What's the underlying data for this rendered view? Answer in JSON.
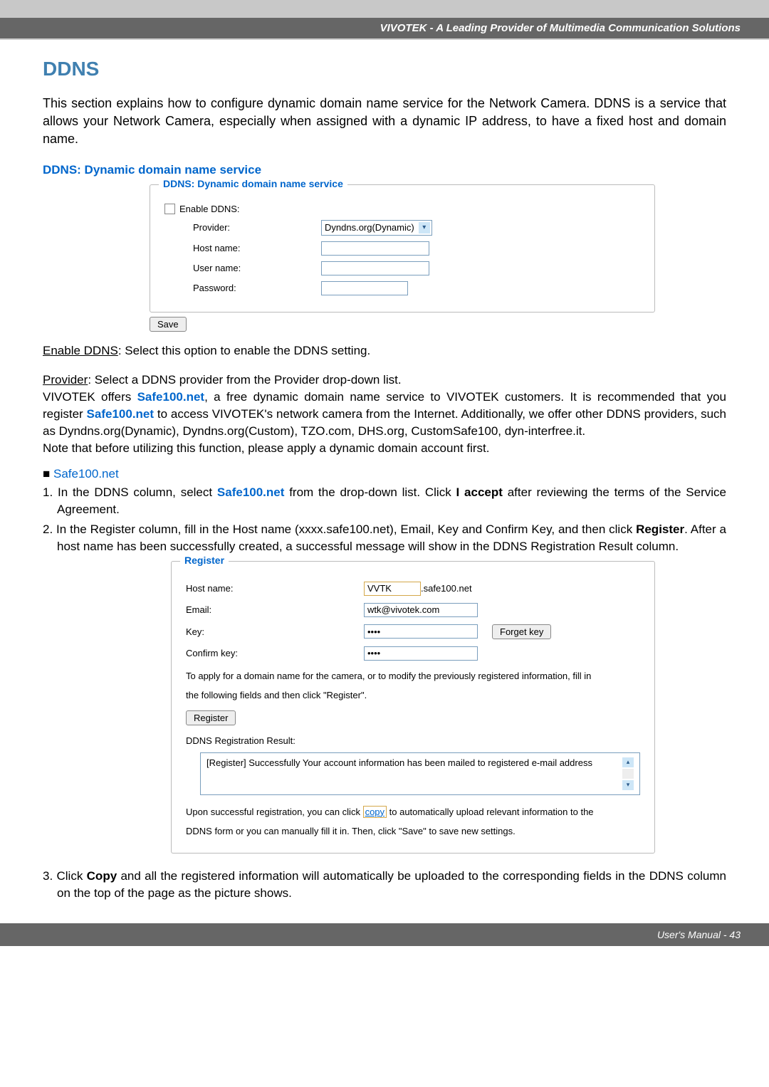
{
  "header": {
    "title": "VIVOTEK - A Leading Provider of Multimedia Communication Solutions"
  },
  "section": {
    "title": "DDNS",
    "intro": "This section explains how to configure dynamic domain name service for the Network Camera. DDNS is a service that allows your Network Camera, especially when assigned with a dynamic IP address, to have a fixed host and domain name.",
    "subtitle": "DDNS: Dynamic domain name service"
  },
  "ddns_form": {
    "legend": "DDNS: Dynamic domain name service",
    "enable_label": "Enable DDNS:",
    "provider_label": "Provider:",
    "provider_value": "Dyndns.org(Dynamic)",
    "hostname_label": "Host name:",
    "username_label": "User name:",
    "password_label": "Password:",
    "save_button": "Save"
  },
  "body": {
    "enable_ddns_label": "Enable DDNS",
    "enable_ddns_text": ": Select this option to enable the DDNS setting.",
    "provider_label": "Provider",
    "provider_text": ": Select a DDNS provider from the Provider drop-down list.",
    "vivotek_line1_a": "VIVOTEK offers ",
    "safe100": "Safe100.net",
    "vivotek_line1_b": ", a free dynamic domain name service to VIVOTEK customers. It is recommended that you register ",
    "vivotek_line1_c": " to access VIVOTEK's network camera from the Internet. Additionally, we offer other DDNS providers, such as Dyndns.org(Dynamic), Dyndns.org(Custom), TZO.com, DHS.org, CustomSafe100, dyn-interfree.it.",
    "note_line": "Note that before utilizing this function, please apply a dynamic domain account first.",
    "bullet": "■ ",
    "step1_a": "1. In the DDNS column, select ",
    "step1_b": " from the drop-down list. Click ",
    "i_accept": "I accept",
    "step1_c": " after reviewing the terms of the Service Agreement.",
    "step2_a": "2. In the Register column, fill in the Host name (xxxx.safe100.net), Email, Key and Confirm Key, and then click ",
    "register_bold": "Register",
    "step2_b": ". After a host name has been successfully created, a successful message will show in the DDNS Registration Result column."
  },
  "register_form": {
    "legend": "Register",
    "hostname_label": "Host name:",
    "hostname_value": "VVTK",
    "hostname_suffix": ".safe100.net",
    "email_label": "Email:",
    "email_value": "wtk@vivotek.com",
    "key_label": "Key:",
    "key_value": "••••",
    "forget_key": "Forget key",
    "confirmkey_label": "Confirm key:",
    "confirmkey_value": "••••",
    "desc1": "To apply for a domain name for the camera, or to modify the previously registered information, fill in",
    "desc2": "the following fields and then click \"Register\".",
    "register_button": "Register",
    "result_label": "DDNS Registration Result:",
    "result_text": "[Register] Successfully  Your account information has been mailed to registered e-mail address",
    "footer1a": "Upon successful registration, you can click ",
    "copy_link": "copy",
    "footer1b": " to automatically upload relevant information to the",
    "footer2": "DDNS form or you can manually fill it in. Then, click \"Save\" to save new settings."
  },
  "step3": {
    "a": "3. Click ",
    "copy": "Copy",
    "b": " and all the registered information will automatically be uploaded to the corresponding fields in the DDNS column on the top of the page as the picture shows."
  },
  "footer": {
    "text": "User's Manual - 43"
  }
}
